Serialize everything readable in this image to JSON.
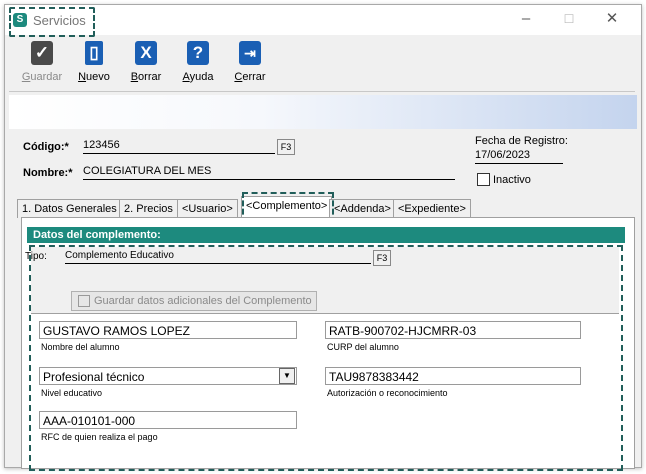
{
  "window": {
    "title": "Servicios",
    "icon_letter": "S",
    "minimize": "–",
    "maximize": "☐",
    "close": "✕"
  },
  "toolbar": {
    "guardar": {
      "label": "Guardar",
      "mnemonic": "G",
      "rest": "uardar"
    },
    "nuevo": {
      "label": "Nuevo",
      "mnemonic": "N",
      "rest": "uevo"
    },
    "borrar": {
      "label": "Borrar",
      "mnemonic": "B",
      "rest": "orrar"
    },
    "ayuda": {
      "label": "Ayuda",
      "mnemonic": "A",
      "rest": "yuda"
    },
    "cerrar": {
      "label": "Cerrar",
      "mnemonic": "C",
      "rest": "errar"
    }
  },
  "form": {
    "codigo_label": "Código:*",
    "codigo_value": "123456",
    "nombre_label": "Nombre:*",
    "nombre_value": "COLEGIATURA DEL MES",
    "f3": "F3",
    "fecha_label": "Fecha de Registro:",
    "fecha_value": "17/06/2023",
    "inactivo_label": "Inactivo",
    "inactivo_checked": false
  },
  "tabs": [
    {
      "label": "1. Datos Generales"
    },
    {
      "label": "2. Precios"
    },
    {
      "label": "<Usuario>"
    },
    {
      "label": "<Complemento>"
    },
    {
      "label": "<Addenda>"
    },
    {
      "label": "<Expediente>"
    }
  ],
  "active_tab": "<Complemento>",
  "complemento": {
    "section_title": "Datos del complemento:",
    "tipo_label": "Tipo:",
    "tipo_value": "Complemento Educativo",
    "guardar_btn": "Guardar datos adicionales del Complemento",
    "nombre_alumno_value": "GUSTAVO RAMOS LOPEZ",
    "nombre_alumno_label": "Nombre del alumno",
    "curp_value": "RATB-900702-HJCMRR-03",
    "curp_label": "CURP del alumno",
    "nivel_value": "Profesional técnico",
    "nivel_label": "Nivel educativo",
    "autorizacion_value": "TAU9878383442",
    "autorizacion_label": "Autorización o reconocimiento",
    "rfc_value": "AAA-010101-000",
    "rfc_label": "RFC de quien realiza el pago"
  },
  "colors": {
    "accent": "#1d8a7e",
    "highlight_border": "#215e5a",
    "toolbar_icon": "#1a5fb4"
  }
}
